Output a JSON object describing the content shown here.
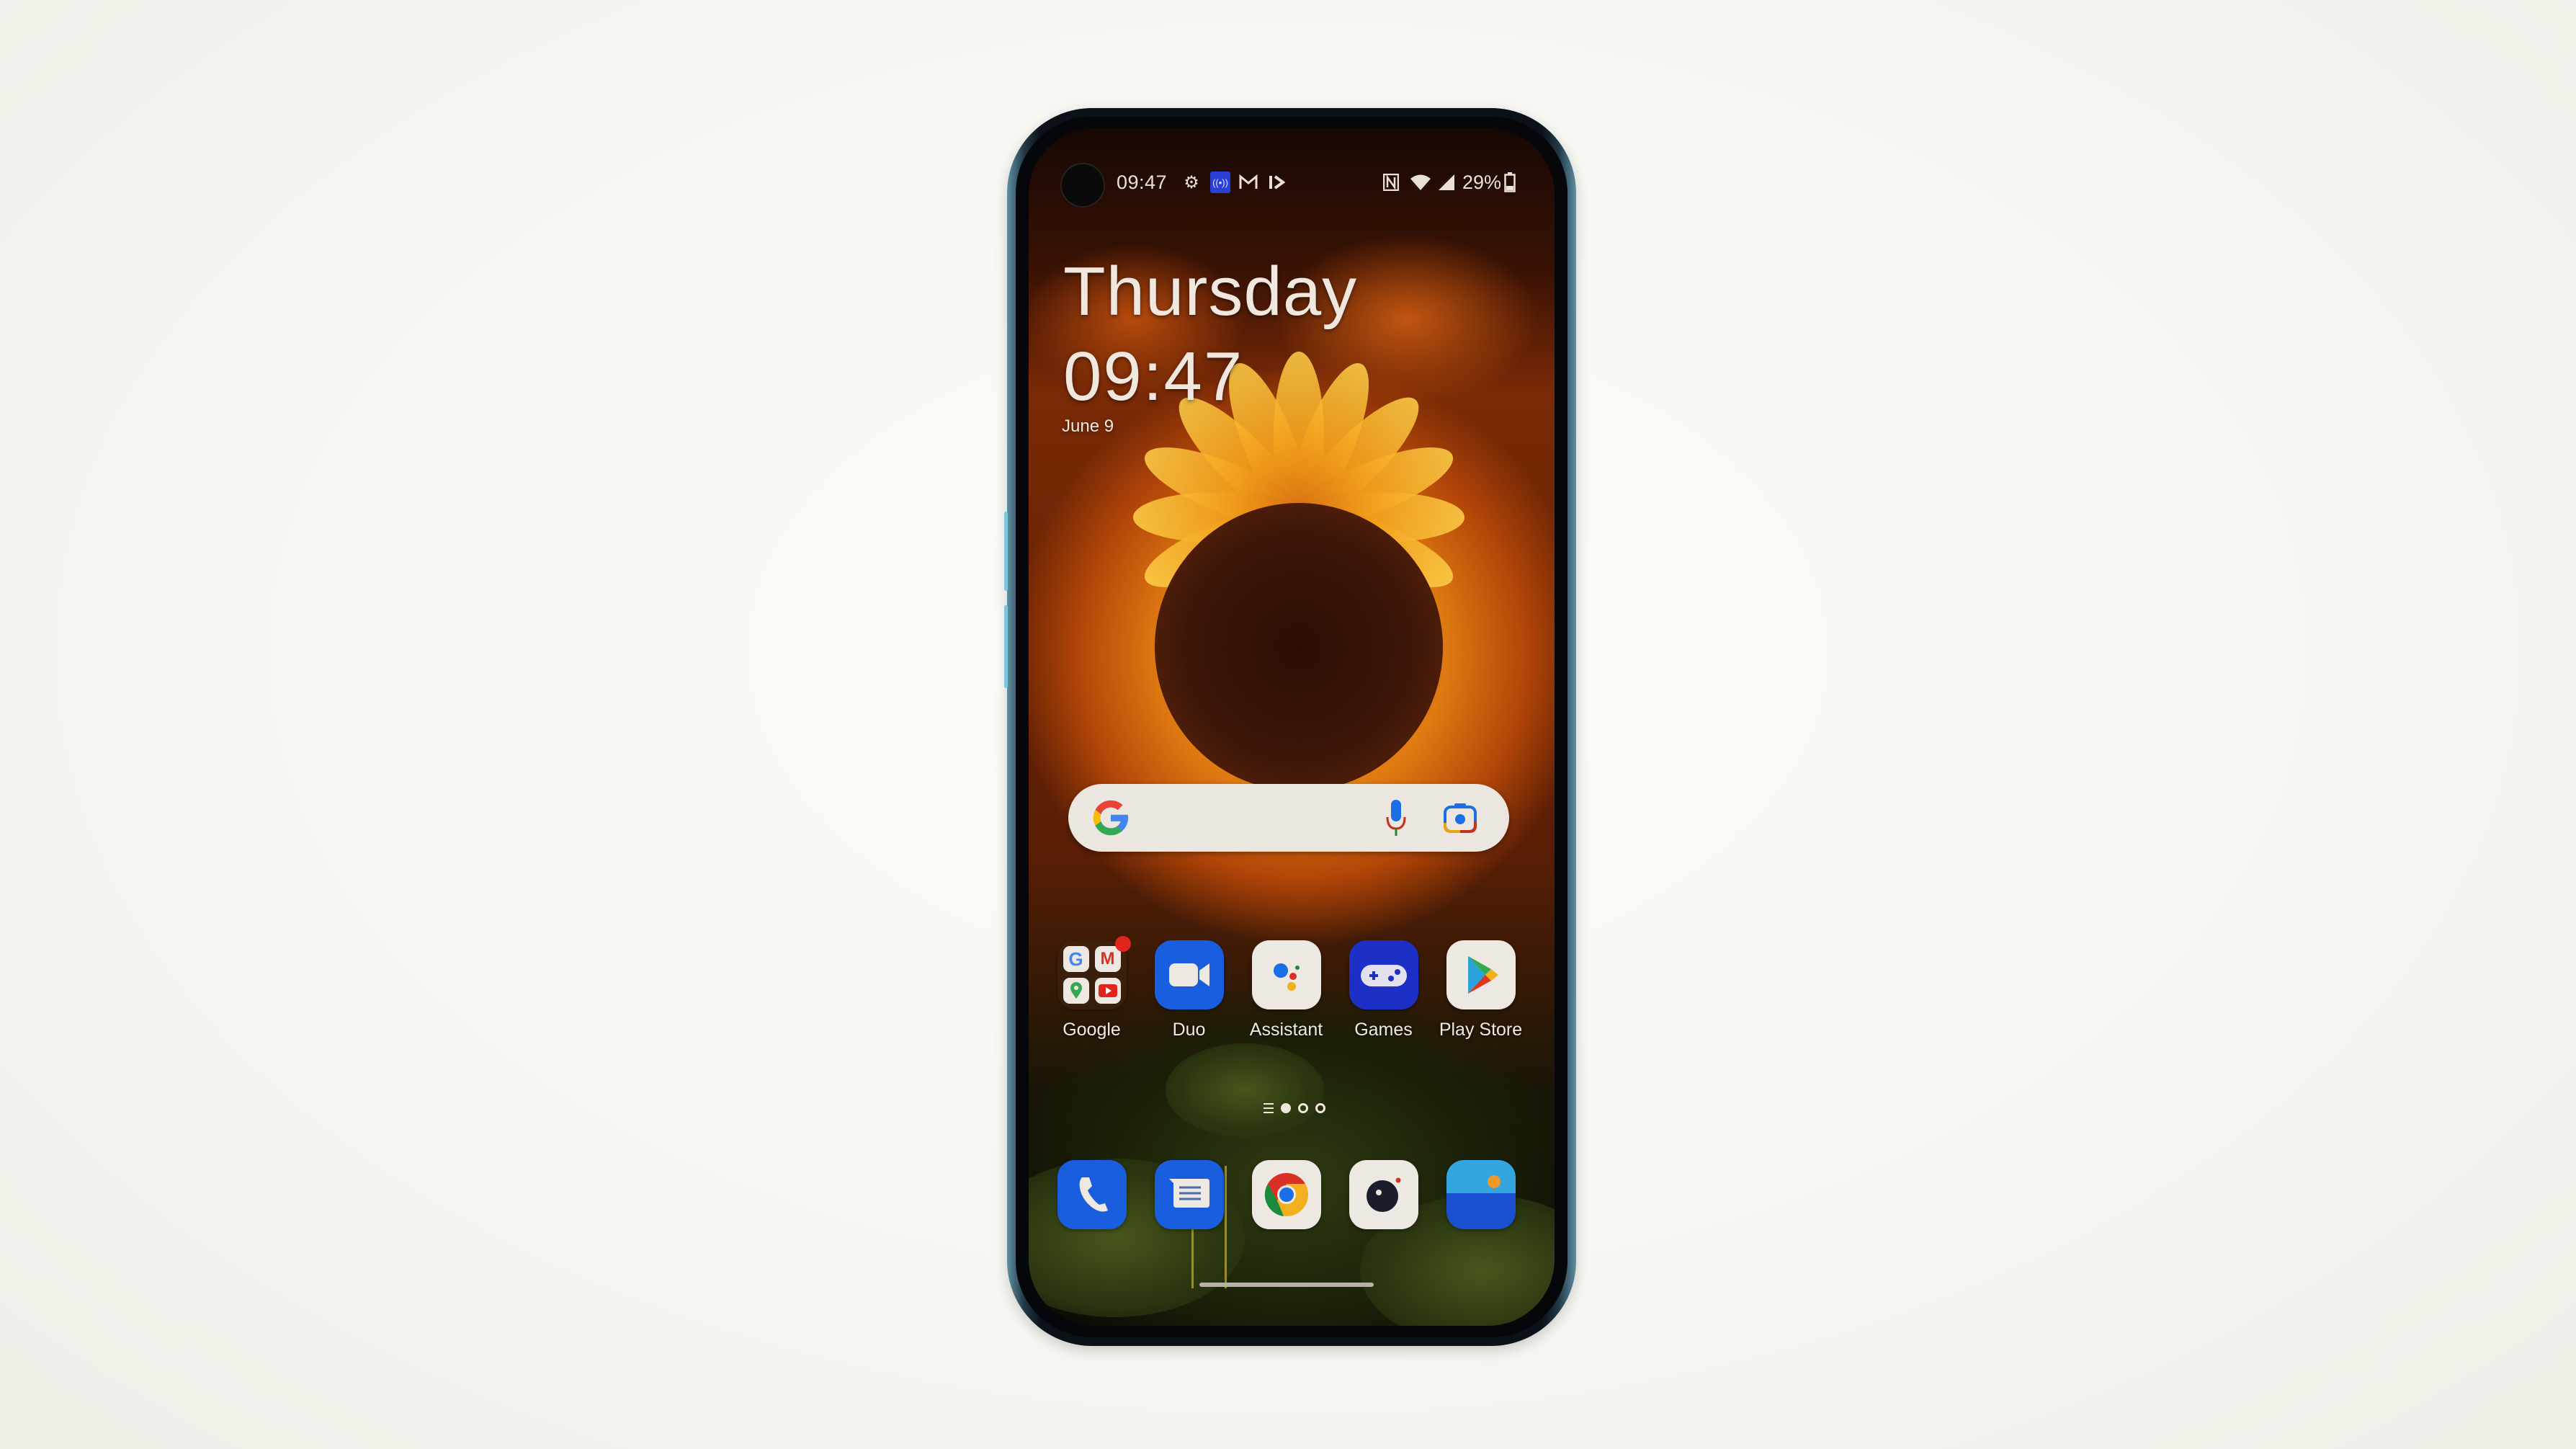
{
  "status_bar": {
    "time": "09:47",
    "left_icons": [
      "gear-icon",
      "hotspot-icon",
      "gmail-notification-icon",
      "play-notification-icon"
    ],
    "right_icons": [
      "nfc-icon",
      "wifi-icon",
      "cell-signal-icon"
    ],
    "battery_percent": "29%",
    "battery_level": 0.29
  },
  "clock_widget": {
    "day": "Thursday",
    "time": "09:47",
    "date": "June 9"
  },
  "search_bar": {
    "logo": "google-g-icon",
    "mic": "microphone-icon",
    "lens": "google-lens-icon"
  },
  "home_apps": [
    {
      "label": "Google",
      "icon": "google-folder-icon",
      "badge": true
    },
    {
      "label": "Duo",
      "icon": "duo-icon"
    },
    {
      "label": "Assistant",
      "icon": "assistant-icon"
    },
    {
      "label": "Games",
      "icon": "games-icon"
    },
    {
      "label": "Play Store",
      "icon": "play-store-icon"
    }
  ],
  "page_indicator": {
    "pages": 3,
    "current": 1,
    "has_list_page": true
  },
  "dock": [
    {
      "name": "Phone",
      "icon": "phone-icon"
    },
    {
      "name": "Messages",
      "icon": "messages-icon"
    },
    {
      "name": "Chrome",
      "icon": "chrome-icon"
    },
    {
      "name": "Camera",
      "icon": "camera-icon"
    },
    {
      "name": "Gallery",
      "icon": "gallery-icon"
    }
  ],
  "colors": {
    "icon_blue": "#1a5ee0",
    "games_blue": "#1c2fc7",
    "icon_white": "#eee8e2",
    "hotspot_blue": "#2a3fd6",
    "badge_red": "#e0241e"
  }
}
